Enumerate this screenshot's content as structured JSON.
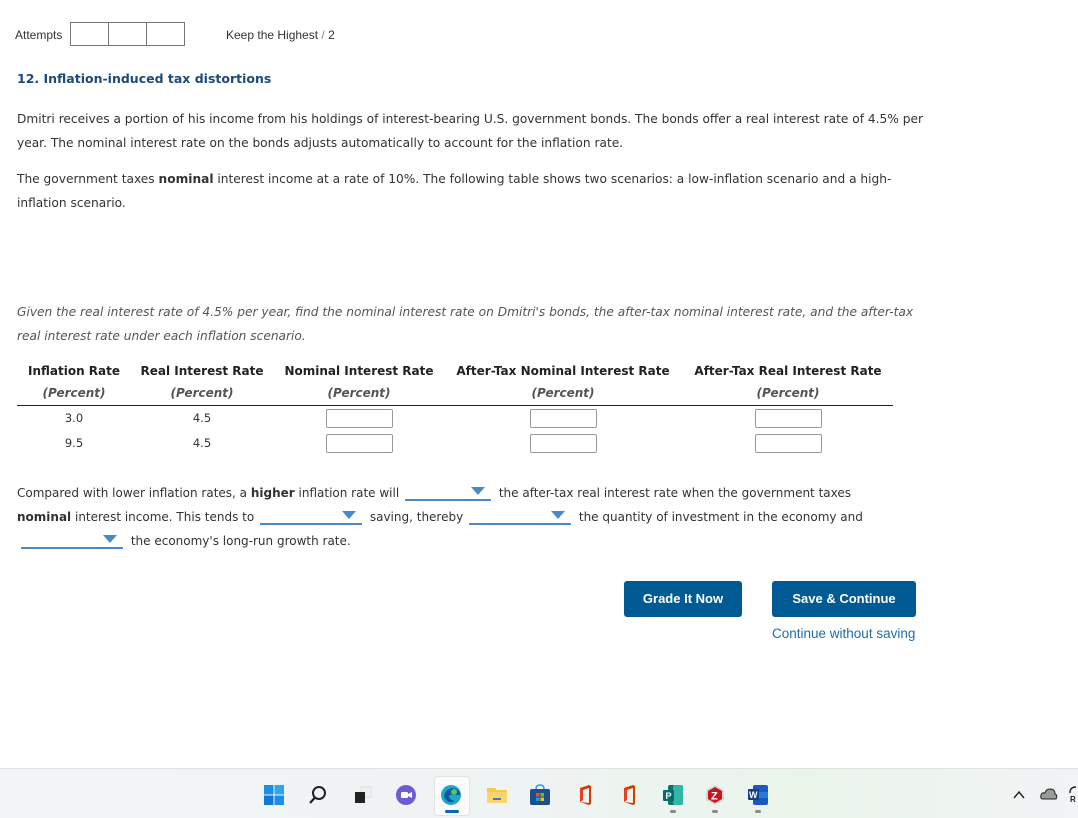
{
  "header": {
    "attempts_label": "Attempts",
    "attempt_boxes": 3,
    "keep_label": "Keep the Highest",
    "slash": " / ",
    "points": "2"
  },
  "question": {
    "title": "12. Inflation-induced tax distortions",
    "para1": "Dmitri receives a portion of his income from his holdings of interest-bearing U.S. government bonds. The bonds offer a real interest rate of 4.5% per year. The nominal interest rate on the bonds adjusts automatically to account for the inflation rate.",
    "para2_pre": "The government taxes ",
    "para2_bold": "nominal",
    "para2_post": " interest income at a rate of 10%. The following table shows two scenarios: a low-inflation scenario and a high-inflation scenario.",
    "para3": "Given the real interest rate of 4.5% per year, find the nominal interest rate on Dmitri's bonds, the after-tax nominal interest rate, and the after-tax real interest rate under each inflation scenario."
  },
  "table": {
    "columns": [
      {
        "title": "Inflation Rate",
        "sub": "(Percent)"
      },
      {
        "title": "Real Interest Rate",
        "sub": "(Percent)"
      },
      {
        "title": "Nominal Interest Rate",
        "sub": "(Percent)"
      },
      {
        "title": "After-Tax Nominal Interest Rate",
        "sub": "(Percent)"
      },
      {
        "title": "After-Tax Real Interest Rate",
        "sub": "(Percent)"
      }
    ],
    "rows": [
      {
        "inflation": "3.0",
        "real": "4.5",
        "nominal": "",
        "after_tax_nominal": "",
        "after_tax_real": ""
      },
      {
        "inflation": "9.5",
        "real": "4.5",
        "nominal": "",
        "after_tax_nominal": "",
        "after_tax_real": ""
      }
    ]
  },
  "fill_in": {
    "s1_pre": "Compared with lower inflation rates, a ",
    "s1_bold": "higher",
    "s1_mid": " inflation rate will",
    "s1_post": "the after-tax real interest rate when the government taxes",
    "s2_bold": "nominal",
    "s2_pre": " interest income. This tends to",
    "s2_mid": "saving, thereby",
    "s2_post": "the quantity of investment in the economy and",
    "s3_post": "the economy's long-run growth rate.",
    "dropdowns": [
      "",
      "",
      "",
      ""
    ]
  },
  "actions": {
    "grade": "Grade It Now",
    "save": "Save & Continue",
    "continue": "Continue without saving"
  },
  "taskbar": {
    "icons": [
      "windows-start",
      "search",
      "task-view",
      "teams-chat",
      "edge",
      "file-explorer",
      "microsoft-store",
      "office",
      "office",
      "publisher",
      "zotero",
      "word"
    ],
    "tray": [
      "chevron-up",
      "onedrive-cloud"
    ]
  },
  "colors": {
    "title": "#1b4b7a",
    "button": "#005b94",
    "link": "#1f6ea8",
    "dropdown": "#4a8ac6"
  }
}
